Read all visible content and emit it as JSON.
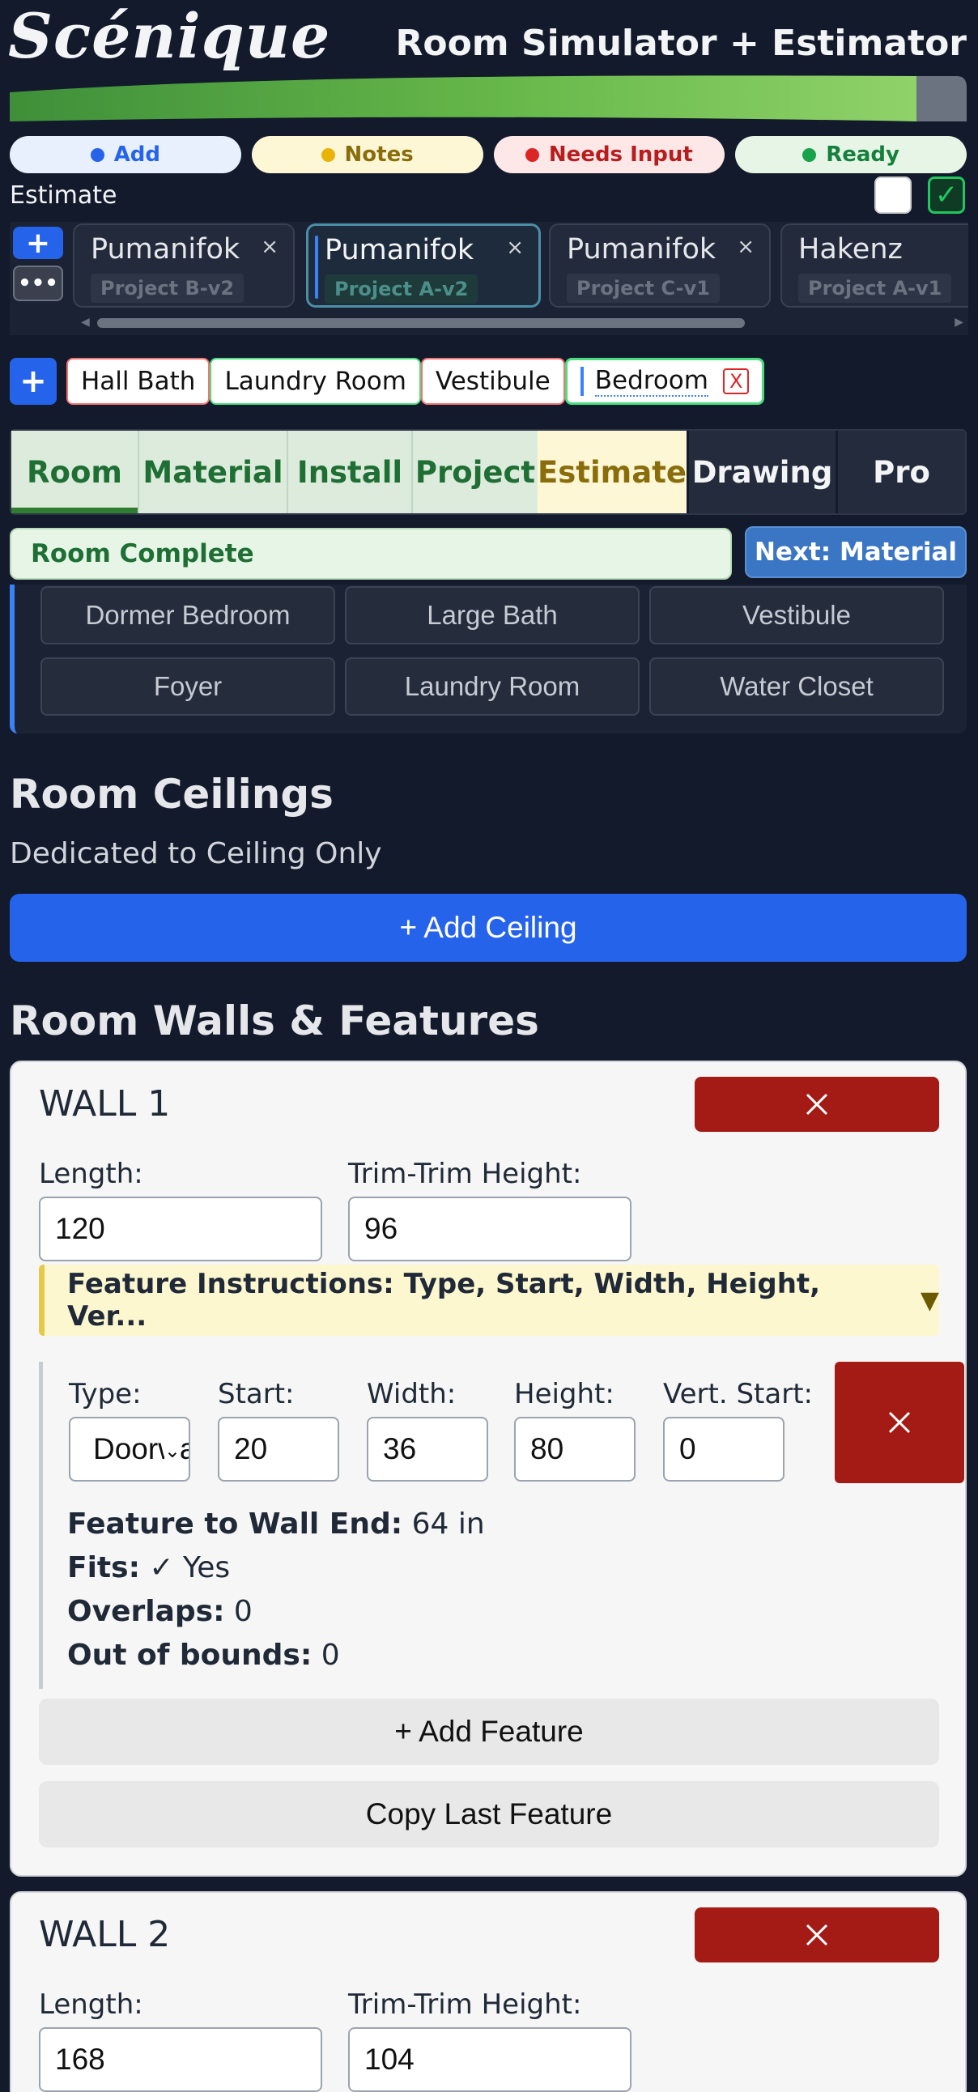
{
  "header": {
    "logo": "Scénique",
    "title": "Room Simulator + Estimator"
  },
  "status": [
    {
      "label": "Add",
      "color": "#2563eb"
    },
    {
      "label": "Notes",
      "color": "#eab308"
    },
    {
      "label": "Needs Input",
      "color": "#dc2626"
    },
    {
      "label": "Ready",
      "color": "#16a34a"
    }
  ],
  "estimate_label": "Estimate",
  "checkbox_mark": "✓",
  "project_strip": {
    "add_label": "+",
    "more_label": "•••",
    "close_glyph": "×",
    "projects": [
      {
        "name": "Pumanifok",
        "version": "Project B-v2",
        "active": false
      },
      {
        "name": "Pumanifok",
        "version": "Project A-v2",
        "active": true
      },
      {
        "name": "Pumanifok",
        "version": "Project C-v1",
        "active": false
      },
      {
        "name": "Hakenz",
        "version": "Project A-v1",
        "active": false
      }
    ],
    "scroll_left": "◀",
    "scroll_right": "▶"
  },
  "rooms": {
    "add_label": "+",
    "tabs": [
      "Hall Bath",
      "Laundry Room",
      "Vestibule",
      "Bedroom"
    ],
    "close_label": "X"
  },
  "nav_tabs": [
    "Room",
    "Material",
    "Install",
    "Project",
    "Estimate",
    "Drawing",
    "Pro"
  ],
  "room_complete": "Room Complete",
  "next_button": "Next: Material",
  "presets": [
    "Dormer Bedroom",
    "Large Bath",
    "Vestibule",
    "Foyer",
    "Laundry Room",
    "Water Closet"
  ],
  "ceilings": {
    "heading": "Room Ceilings",
    "subtitle": "Dedicated to Ceiling Only",
    "add_button": "+ Add Ceiling"
  },
  "walls_heading": "Room Walls & Features",
  "walls": [
    {
      "title": "WALL 1",
      "length_label": "Length:",
      "length": "120",
      "height_label": "Trim-Trim Height:",
      "height": "96",
      "instructions": "Feature Instructions: Type, Start, Width, Height, Ver...",
      "instructions_toggle": "▼",
      "feature": {
        "labels": [
          "Type:",
          "Start:",
          "Width:",
          "Height:",
          "Vert. Start:"
        ],
        "type": "Doorway",
        "start": "20",
        "width": "36",
        "height": "80",
        "vert_start": "0",
        "to_wall_end_label": "Feature to Wall End:",
        "to_wall_end": "64 in",
        "fits_label": "Fits:",
        "fits": "✓ Yes",
        "overlaps_label": "Overlaps:",
        "overlaps": "0",
        "oob_label": "Out of bounds:",
        "oob": "0"
      },
      "add_feature": "+ Add Feature",
      "copy_feature": "Copy Last Feature"
    },
    {
      "title": "WALL 2",
      "length_label": "Length:",
      "length": "168",
      "height_label": "Trim-Trim Height:",
      "height": "104"
    }
  ]
}
